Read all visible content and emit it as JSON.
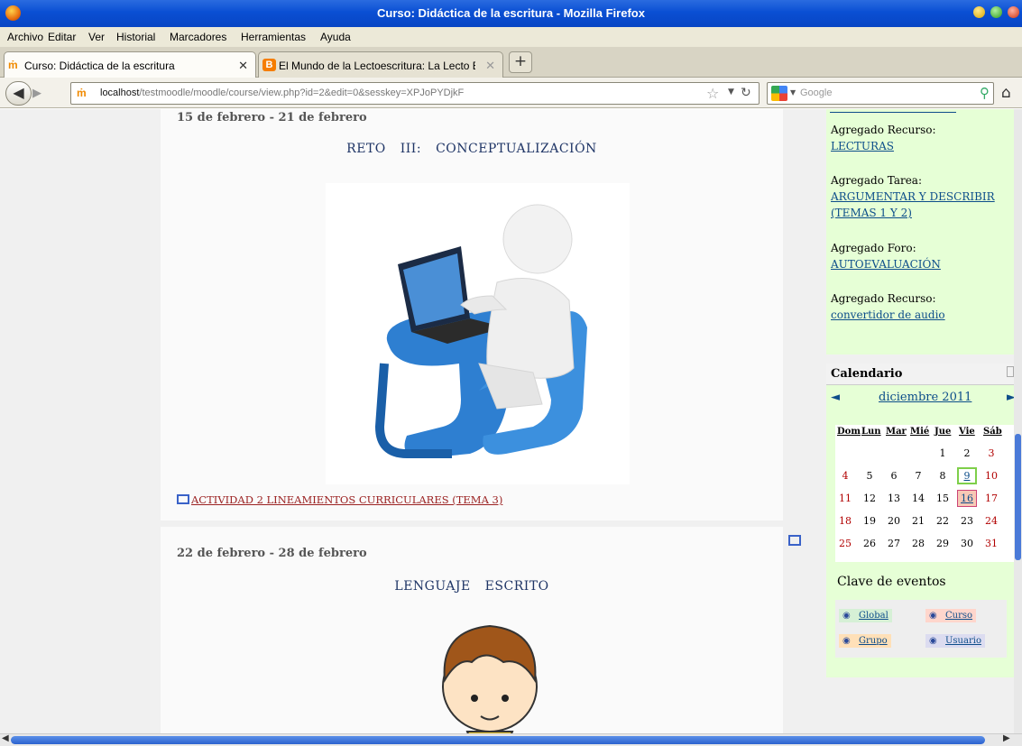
{
  "window": {
    "title": "Curso: Didáctica de la escritura - Mozilla Firefox"
  },
  "menu": [
    "Archivo",
    "Editar",
    "Ver",
    "Historial",
    "Marcadores",
    "Herramientas",
    "Ayuda"
  ],
  "tabs": [
    {
      "label": "Curso: Didáctica de la escritura",
      "icon": "moodle-icon",
      "active": true
    },
    {
      "label": "El Mundo de la Lectoescritura: La Lecto E...",
      "icon": "blogger-icon",
      "active": false
    }
  ],
  "nav": {
    "url_host": "localhost",
    "url_path": "/testmoodle/moodle/course/view.php?id=2&edit=0&sesskey=XPJoPYDjkF",
    "search_placeholder": "Google"
  },
  "weeks": [
    {
      "date": "15 de febrero - 21 de febrero",
      "heading": [
        "RETO",
        "III:",
        "CONCEPTUALIZACIÓN"
      ],
      "activity": "ACTIVIDAD 2 LINEAMIENTOS CURRICULARES (TEMA 3)"
    },
    {
      "date": "22 de febrero - 28 de febrero",
      "heading": [
        "LENGUAJE",
        "ESCRITO"
      ]
    }
  ],
  "recent_activity": [
    {
      "label": "Agregado Recurso:",
      "link": "LECTURAS"
    },
    {
      "label": "Agregado Tarea:",
      "link": "ARGUMENTAR Y DESCRIBIR (TEMAS 1 Y 2)"
    },
    {
      "label": "Agregado Foro:",
      "link": "AUTOEVALUACIÓN"
    },
    {
      "label": "Agregado Recurso:",
      "link": "convertidor de audio"
    }
  ],
  "calendar": {
    "title": "Calendario",
    "month": "diciembre 2011",
    "prev": "◄",
    "next": "►",
    "days_of_week": [
      "Dom",
      "Lun",
      "Mar",
      "Mié",
      "Jue",
      "Vie",
      "Sáb"
    ],
    "weeks": [
      [
        "",
        "",
        "",
        "",
        "1",
        "2",
        "3"
      ],
      [
        "4",
        "5",
        "6",
        "7",
        "8",
        "9",
        "10"
      ],
      [
        "11",
        "12",
        "13",
        "14",
        "15",
        "16",
        "17"
      ],
      [
        "18",
        "19",
        "20",
        "21",
        "22",
        "23",
        "24"
      ],
      [
        "25",
        "26",
        "27",
        "28",
        "29",
        "30",
        "31"
      ]
    ],
    "today": "9",
    "event_day": "16"
  },
  "event_keys": {
    "title": "Clave de eventos",
    "items": [
      "Global",
      "Curso",
      "Grupo",
      "Usuario"
    ]
  },
  "colors": {
    "link": "#0d4d8a",
    "weekend": "#b10000",
    "block_bg": "#e6ffd6",
    "activity_link": "#9b2222"
  }
}
